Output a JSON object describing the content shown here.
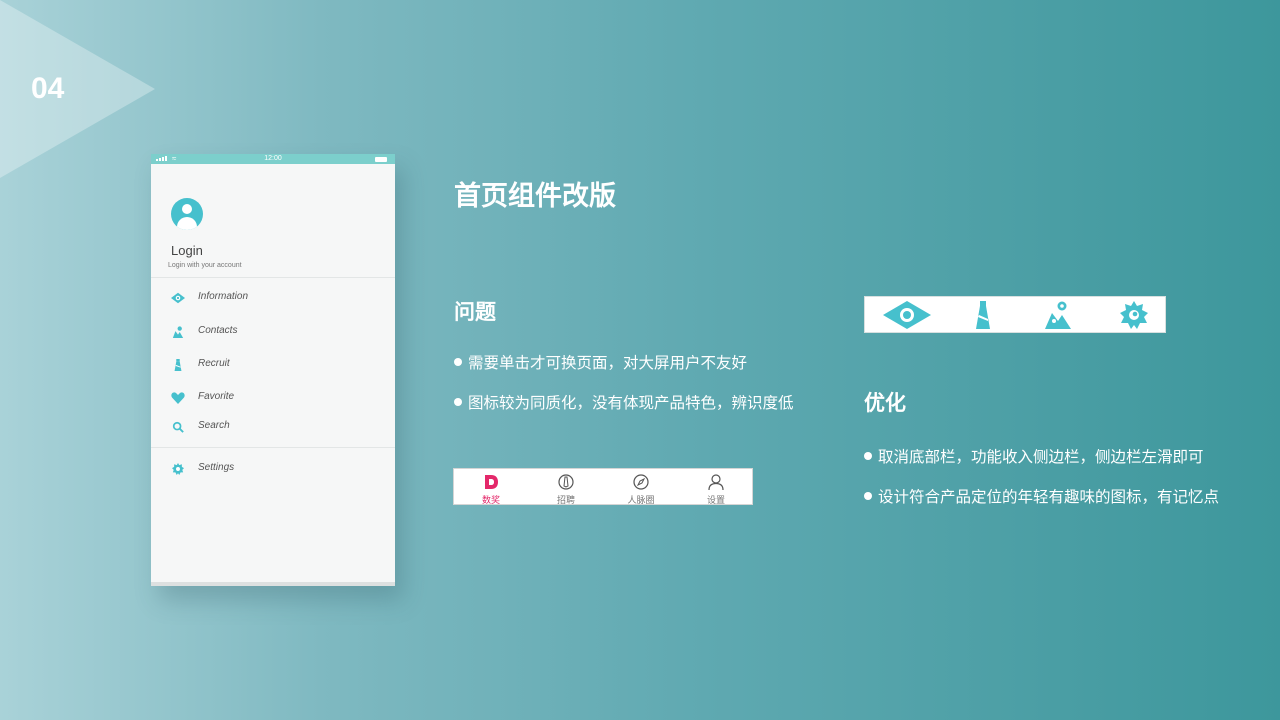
{
  "slide": {
    "number": "04"
  },
  "phone": {
    "status": {
      "time": "12:00"
    },
    "profile": {
      "title": "Login",
      "subtitle": "Login with your account"
    },
    "menu": [
      {
        "label": "Information",
        "icon": "eye-icon"
      },
      {
        "label": "Contacts",
        "icon": "contacts-icon"
      },
      {
        "label": "Recruit",
        "icon": "tie-icon"
      },
      {
        "label": "Favorite",
        "icon": "heart-icon"
      },
      {
        "label": "Search",
        "icon": "search-icon"
      },
      {
        "label": "Settings",
        "icon": "gear-icon"
      }
    ]
  },
  "content": {
    "title": "首页组件改版",
    "problem": {
      "heading": "问题",
      "bullets": [
        "需要单击才可换页面，对大屏用户不友好",
        "图标较为同质化，没有体现产品特色，辨识度低"
      ]
    },
    "optimize": {
      "heading": "优化",
      "bullets": [
        "取消底部栏，功能收入侧边栏，侧边栏左滑即可",
        "设计符合产品定位的年轻有趣味的图标，有记忆点"
      ]
    },
    "old_tabbar": [
      {
        "label": "数奖",
        "icon": "d-logo-icon",
        "active": true
      },
      {
        "label": "招聘",
        "icon": "tie-outline-icon",
        "active": false
      },
      {
        "label": "人脉圈",
        "icon": "compass-icon",
        "active": false
      },
      {
        "label": "设置",
        "icon": "user-outline-icon",
        "active": false
      }
    ],
    "new_icons": [
      "eye-icon",
      "tie-icon",
      "contacts-icon",
      "gear-icon"
    ]
  },
  "colors": {
    "accent": "#46c0cd",
    "status_bar": "#7ccfcc",
    "active_tab": "#e4286a"
  }
}
